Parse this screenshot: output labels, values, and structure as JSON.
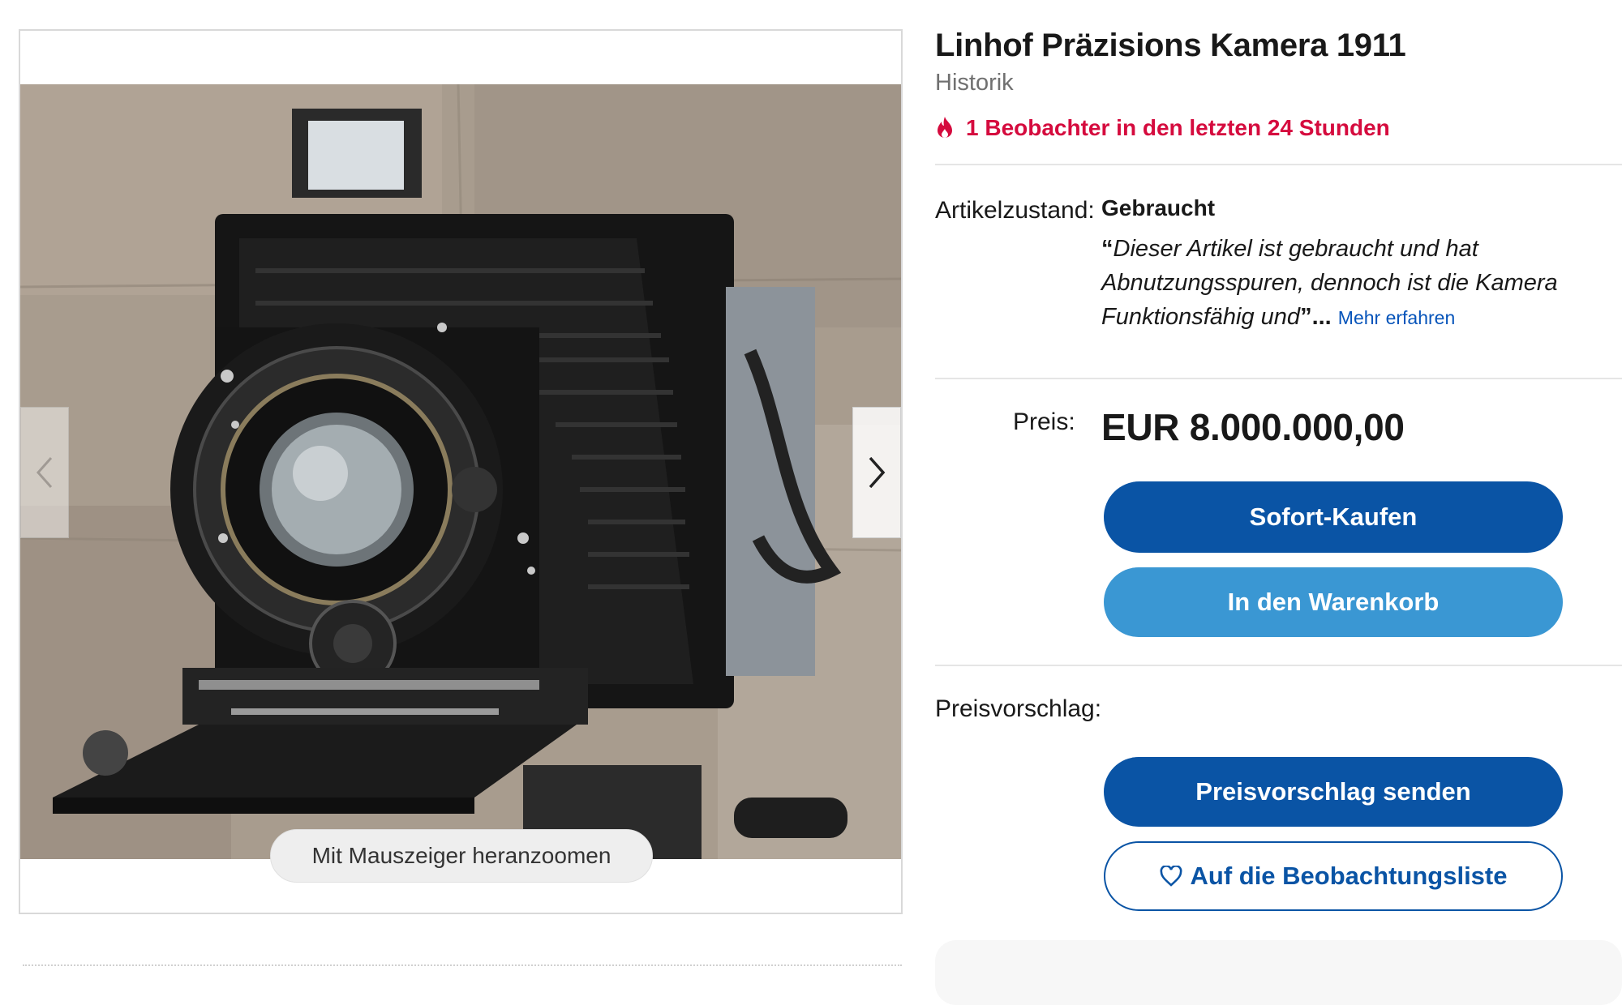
{
  "gallery": {
    "zoom_hint": "Mit Mauszeiger heranzoomen",
    "image_alt": "Linhof Präzisions Kamera 1911",
    "prev_icon": "chevron-left-icon",
    "next_icon": "chevron-right-icon"
  },
  "item": {
    "title": "Linhof Präzisions Kamera 1911",
    "subtitle": "Historik",
    "watchers": "1 Beobachter in den letzten 24 Stunden",
    "watchers_icon": "flame-icon"
  },
  "condition": {
    "label": "Artikelzustand:",
    "value": "Gebraucht",
    "quote_open": "“",
    "quote": "Dieser Artikel ist gebraucht und hat Abnutzungsspuren, dennoch ist die Kamera Funktionsfähig und",
    "quote_close": "”",
    "ellipsis": "...",
    "more_link": "Mehr erfahren"
  },
  "price": {
    "label": "Preis:",
    "value": "EUR 8.000.000,00"
  },
  "actions": {
    "buy_now": "Sofort-Kaufen",
    "add_to_cart": "In den Warenkorb",
    "offer_label": "Preisvorschlag:",
    "send_offer": "Preisvorschlag senden",
    "watchlist": "Auf die Beobachtungsliste",
    "watchlist_icon": "heart-outline-icon"
  },
  "colors": {
    "primary_button": "#0a54a5",
    "secondary_button": "#3a97d3",
    "watchers_text": "#d50b3e",
    "link": "#0654ba"
  }
}
